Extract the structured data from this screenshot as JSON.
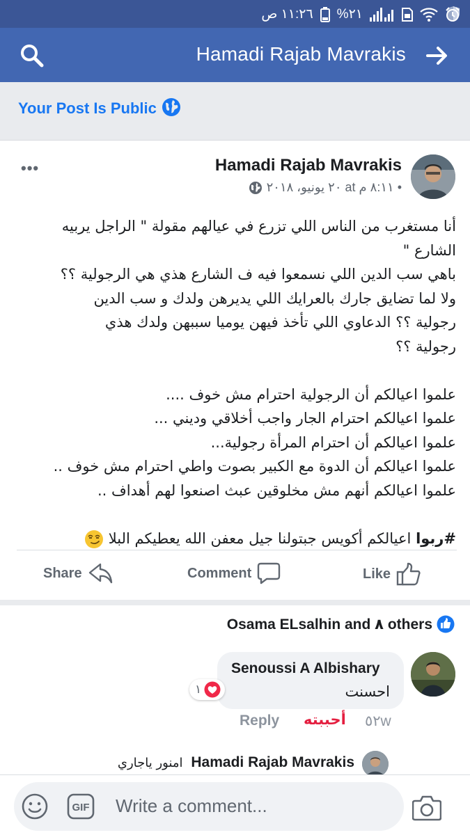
{
  "status_bar": {
    "time": "١١:٢٦ ص",
    "battery": "%٢١",
    "icons": [
      "shield-icon",
      "alarm-icon",
      "wifi-icon",
      "sim-icon",
      "signal-icon",
      "battery-icon"
    ]
  },
  "header": {
    "title": "Hamadi Rajab Mavrakis",
    "icons": [
      "search-icon",
      "forward-arrow-icon"
    ]
  },
  "banner": {
    "text": "Your Post Is Public",
    "icon": "globe-icon"
  },
  "post": {
    "author": "Hamadi Rajab Mavrakis",
    "timestamp": "٢٠ يونيو، ٢٠١٨ at ٨:١١ م •",
    "body_lines": [
      "أنا مستغرب من الناس اللي تزرع في عيالهم مقولة \" الراجل يربيه",
      "الشارع \"",
      "باهي سب الدين اللي نسمعوا فيه ف الشارع هذي هي الرجولية ؟؟",
      "ولا لما تضايق جارك  بالعرايك اللي يديرهن ولدك و سب الدين",
      "رجولية ؟؟ الدعاوي اللي تأخذ فيهن يوميا  سببهن ولدك هذي",
      "رجولية ؟؟",
      "",
      "علموا اعيالكم أن الرجولية احترام مش خوف ....",
      "علموا اعيالكم احترام الجار واجب أخلاقي وديني ...",
      "علموا اعيالكم أن احترام المرأة رجولية...",
      "علموا اعيالكم أن الدوة مع الكبير بصوت واطي احترام مش خوف ..",
      "علموا اعيالكم أنهم مش مخلوقين عبث اصنعوا لهم أهداف ..",
      ""
    ],
    "hashtag": "#ربوا",
    "last_line": " اعيالكم أكويس جبتولنا جيل معفن الله يعطيكم البلا",
    "emoji": "smirk-emoji"
  },
  "actions": {
    "share": "Share",
    "comment": "Comment",
    "like": "Like"
  },
  "likes": {
    "text": "Osama ELsalhin and ٨ others"
  },
  "comment": {
    "name": "Senoussi A Albishary",
    "text": "احسنت",
    "reaction_count": "١",
    "reply": "Reply",
    "love": "أحببته",
    "time": "٥٢w"
  },
  "reply_preview": {
    "name": "Hamadi Rajab Mavrakis",
    "text": "امنور ياجاري"
  },
  "composer": {
    "placeholder": "Write a comment...",
    "gif_label": "GIF"
  },
  "colors": {
    "header_blue": "#4267b2",
    "status_blue": "#3b5696",
    "link_blue": "#1877f2",
    "love_red": "#e41e3f"
  }
}
